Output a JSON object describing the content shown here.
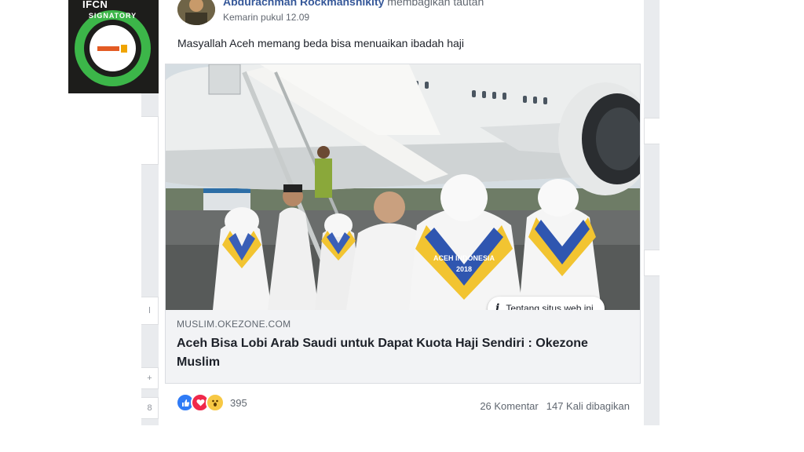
{
  "badge": {
    "title": "IFCN",
    "ring_text": "SIGNATORY"
  },
  "post": {
    "author_name": "Abdurachman Rockmanshikity",
    "author_action": "membagikan tautan",
    "timestamp": "Kemarin pukul 12.09",
    "text": "Masyallah Aceh memang beda bisa menuaikan ibadah haji"
  },
  "link_preview": {
    "about_label": "Tentang situs web ini",
    "domain": "MUSLIM.OKEZONE.COM",
    "headline": "Aceh Bisa Lobi Arab Saudi untuk Dapat Kuota Haji Sendiri : Okezone Muslim",
    "photo_scarf_text_1": "ACEH INDONESIA",
    "photo_scarf_year": "2018"
  },
  "footer": {
    "reaction_count": "395",
    "comments": "26 Komentar",
    "shares": "147 Kali dibagikan"
  },
  "colors": {
    "link_blue": "#365899",
    "ifcn_green": "#3cb649"
  }
}
